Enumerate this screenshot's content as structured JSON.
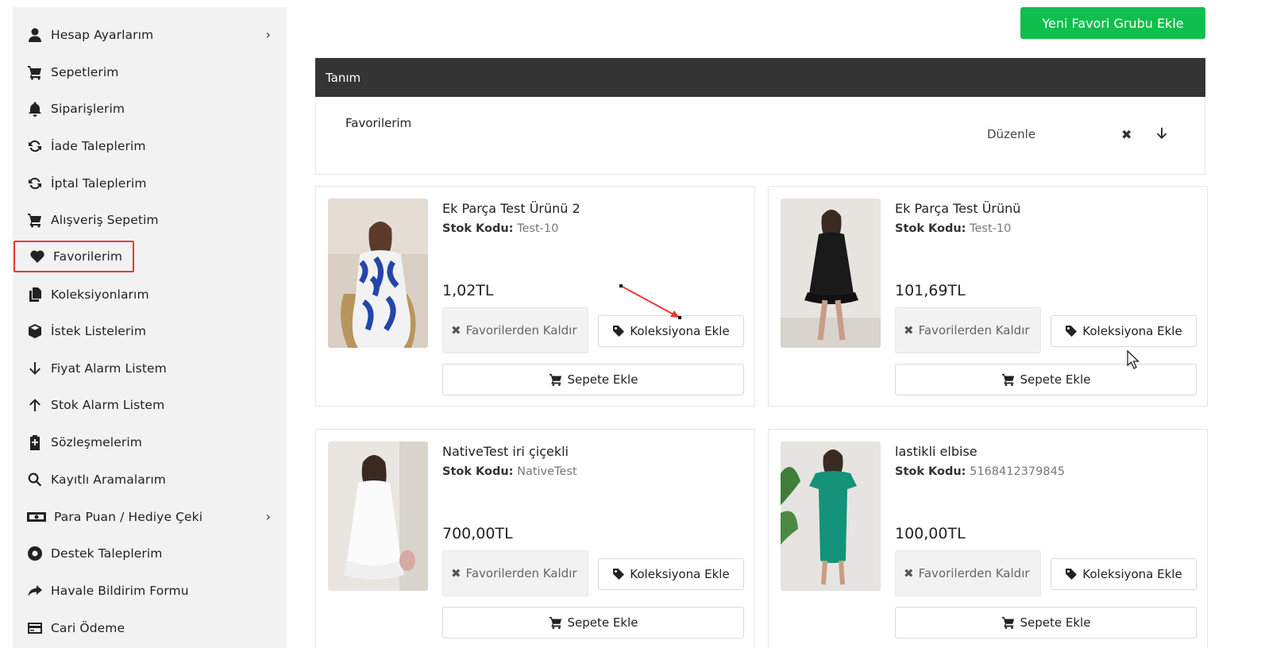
{
  "sidebar": {
    "items": [
      {
        "label": "Hesap Ayarlarım",
        "icon": "user-icon",
        "has_chevron": true
      },
      {
        "label": "Sepetlerim",
        "icon": "cart-icon"
      },
      {
        "label": "Siparişlerim",
        "icon": "bell-icon"
      },
      {
        "label": "İade Taleplerim",
        "icon": "refresh-icon"
      },
      {
        "label": "İptal Taleplerim",
        "icon": "refresh-icon"
      },
      {
        "label": "Alışveriş Sepetim",
        "icon": "cart-icon"
      },
      {
        "label": "Favorilerim",
        "icon": "heart-icon",
        "active": true
      },
      {
        "label": "Koleksiyonlarım",
        "icon": "files-icon"
      },
      {
        "label": "İstek Listelerim",
        "icon": "box-icon"
      },
      {
        "label": "Fiyat Alarm Listem",
        "icon": "arrow-down-icon"
      },
      {
        "label": "Stok Alarm Listem",
        "icon": "arrow-up-icon"
      },
      {
        "label": "Sözleşmelerim",
        "icon": "clipboard-icon"
      },
      {
        "label": "Kayıtlı Aramalarım",
        "icon": "search-icon"
      },
      {
        "label": "Para Puan / Hediye Çeki",
        "icon": "money-icon",
        "has_chevron": true
      },
      {
        "label": "Destek Taleplerim",
        "icon": "lifebuoy-icon"
      },
      {
        "label": "Havale Bildirim Formu",
        "icon": "share-icon"
      },
      {
        "label": "Cari Ödeme",
        "icon": "credit-card-icon"
      }
    ],
    "chevron": "›"
  },
  "header": {
    "add_group_label": "Yeni Favori Grubu Ekle"
  },
  "table": {
    "column_label": "Tanım",
    "group_name": "Favorilerim",
    "edit_label": "Düzenle",
    "delete_glyph": "✖"
  },
  "products": [
    {
      "name": "Ek Parça Test Ürünü 2",
      "code_label": "Stok Kodu:",
      "code": "Test-10",
      "price": "1,02TL",
      "remove_label": "Favorilerden Kaldır",
      "collection_label": "Koleksiyona Ekle",
      "cart_label": "Sepete Ekle"
    },
    {
      "name": "Ek Parça Test Ürünü",
      "code_label": "Stok Kodu:",
      "code": "Test-10",
      "price": "101,69TL",
      "remove_label": "Favorilerden Kaldır",
      "collection_label": "Koleksiyona Ekle",
      "cart_label": "Sepete Ekle"
    },
    {
      "name": "NativeTest iri çiçekli",
      "code_label": "Stok Kodu:",
      "code": "NativeTest",
      "price": "700,00TL",
      "remove_label": "Favorilerden Kaldır",
      "collection_label": "Koleksiyona Ekle",
      "cart_label": "Sepete Ekle"
    },
    {
      "name": "lastikli elbise",
      "code_label": "Stok Kodu:",
      "code": "5168412379845",
      "price": "100,00TL",
      "remove_label": "Favorilerden Kaldır",
      "collection_label": "Koleksiyona Ekle",
      "cart_label": "Sepete Ekle"
    }
  ],
  "remove_glyph": "✖",
  "colors": {
    "accent_green": "#0fbf4d",
    "table_header": "#353535",
    "active_outline": "#e53935",
    "annotation_arrow": "#e53935"
  }
}
